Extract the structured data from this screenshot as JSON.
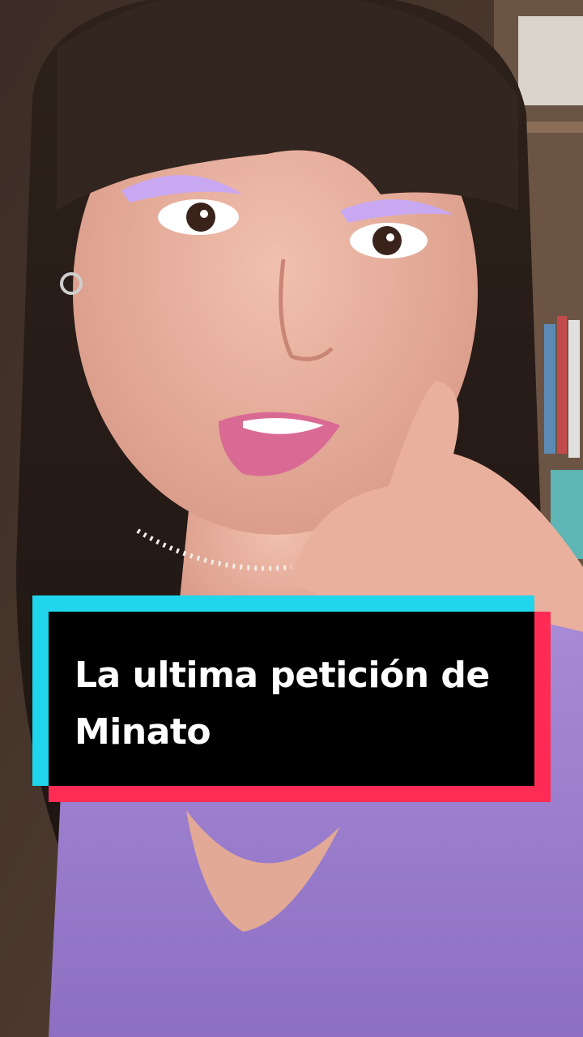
{
  "caption": {
    "text": "La ultima petición de Minato"
  },
  "colors": {
    "caption_cyan": "#20d5ec",
    "caption_red": "#fe2c55",
    "caption_black": "#000000",
    "caption_text": "#ffffff"
  }
}
